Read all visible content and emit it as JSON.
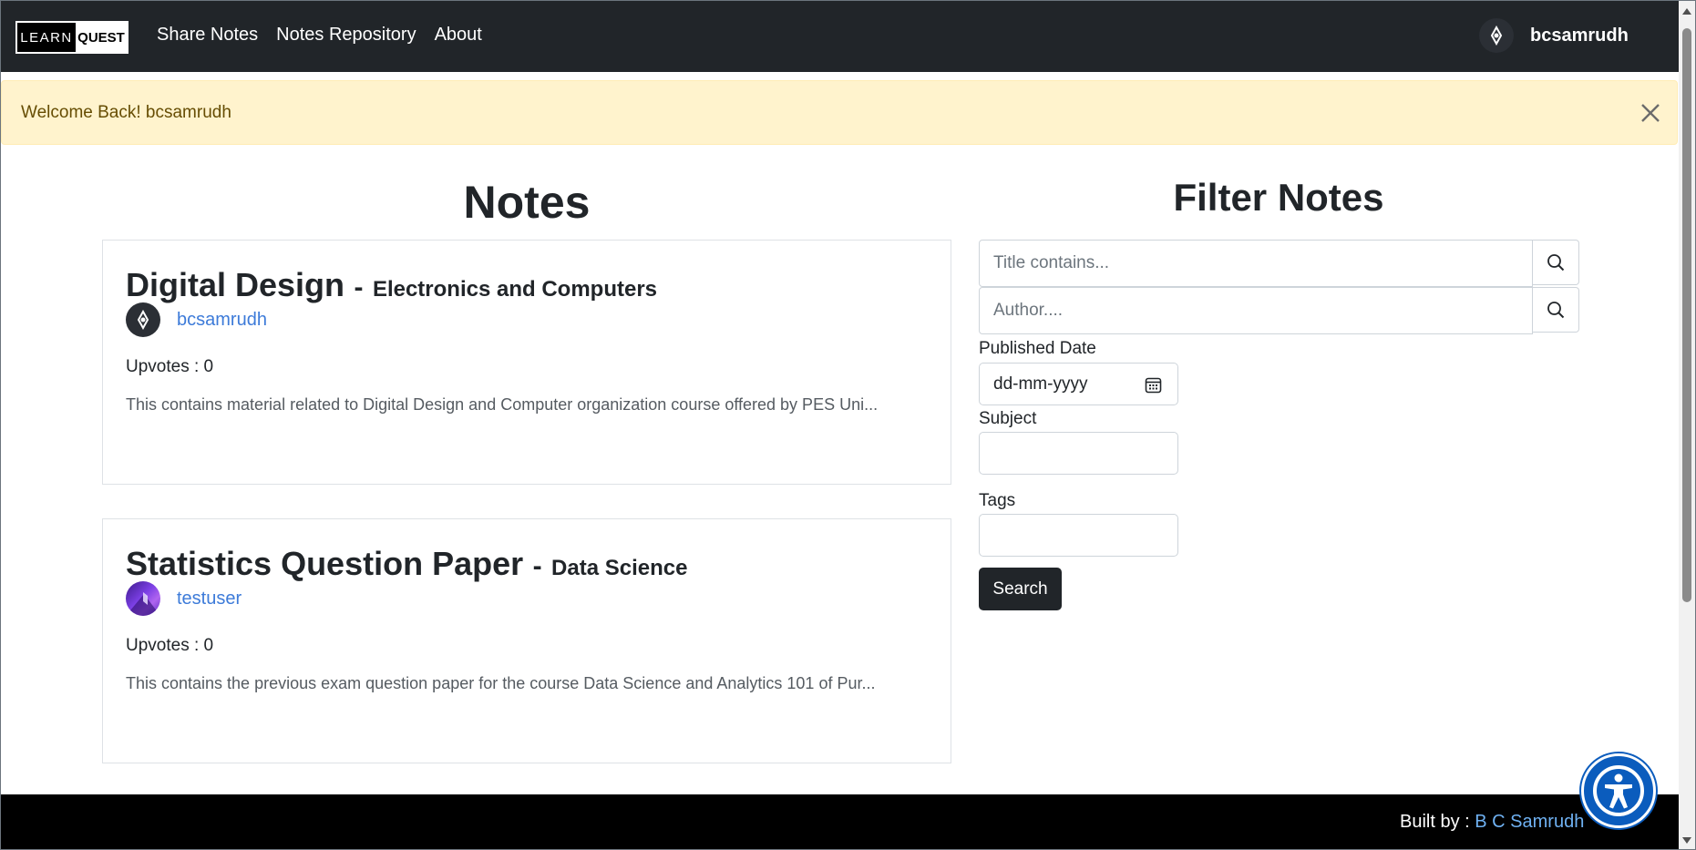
{
  "brand": {
    "learn": "LEARN",
    "quest": "QUEST"
  },
  "nav": {
    "links": [
      "Share Notes",
      "Notes Repository",
      "About"
    ]
  },
  "user": {
    "name": "bcsamrudh"
  },
  "alert": {
    "text": "Welcome Back! bcsamrudh"
  },
  "notes": {
    "heading": "Notes",
    "items": [
      {
        "title": "Digital Design",
        "separator": "-",
        "subject": "Electronics and Computers",
        "author": "bcsamrudh",
        "upvotes": "Upvotes : 0",
        "description": "This contains material related to Digital Design and Computer organization course offered by PES Uni..."
      },
      {
        "title": "Statistics Question Paper",
        "separator": "-",
        "subject": "Data Science",
        "author": "testuser",
        "upvotes": "Upvotes : 0",
        "description": "This contains the previous exam question paper for the course Data Science and Analytics 101 of Pur..."
      }
    ]
  },
  "filter": {
    "heading": "Filter Notes",
    "title_placeholder": "Title contains...",
    "author_placeholder": "Author....",
    "published_date_label": "Published Date",
    "date_placeholder": "dd-mm-yyyy",
    "subject_label": "Subject",
    "tags_label": "Tags",
    "search_label": "Search"
  },
  "footer": {
    "prefix": "Built by : ",
    "author": "B C Samrudh"
  },
  "icons": {
    "search": "search-icon",
    "close": "close-icon",
    "calendar": "calendar-icon",
    "accessibility": "accessibility-icon",
    "avatar": "avatar-icon"
  },
  "colors": {
    "navbar": "#212529",
    "alert_bg": "#fff3cd",
    "alert_text": "#664d03",
    "link": "#3d7bd9",
    "footer_link": "#6fb1f2",
    "accessibility": "#0b5cbd"
  }
}
